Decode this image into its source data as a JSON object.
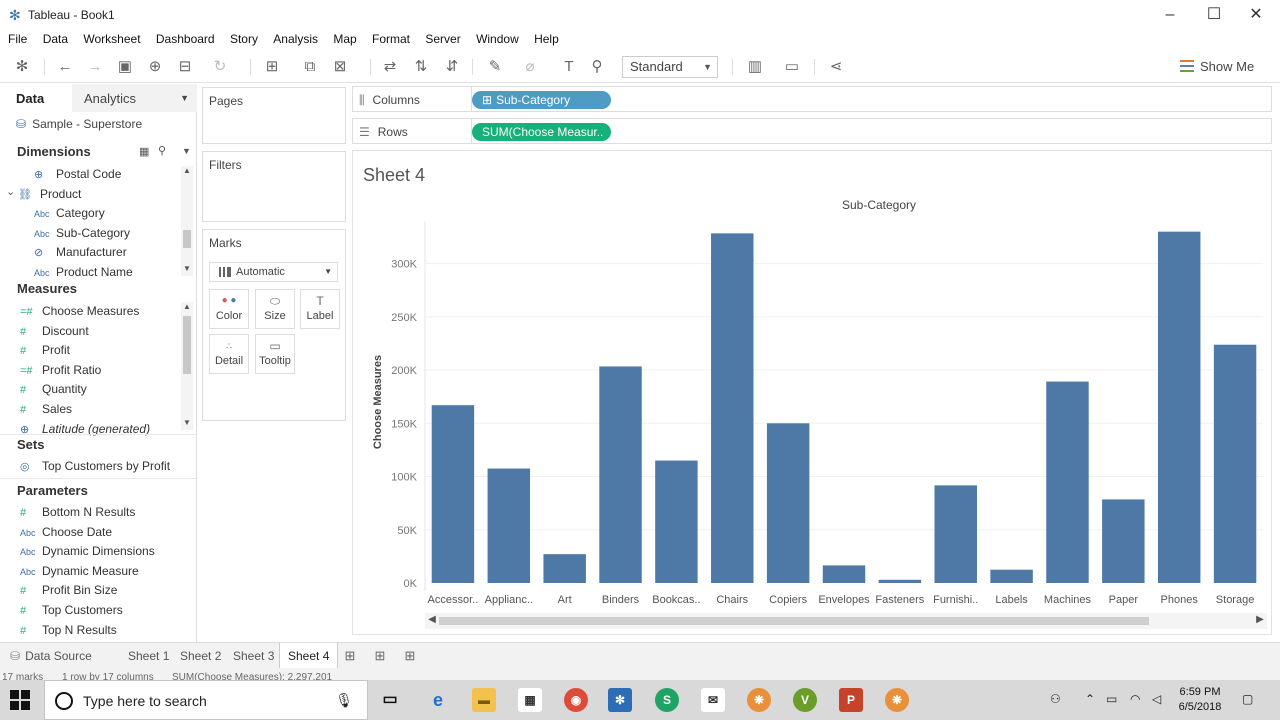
{
  "window": {
    "title": "Tableau - Book1"
  },
  "menu": [
    "File",
    "Data",
    "Worksheet",
    "Dashboard",
    "Story",
    "Analysis",
    "Map",
    "Format",
    "Server",
    "Window",
    "Help"
  ],
  "toolbar": {
    "fit_select": "Standard",
    "show_me": "Show Me"
  },
  "data_pane": {
    "tab_data": "Data",
    "tab_analytics": "Analytics",
    "data_source": "Sample - Superstore",
    "dimensions_label": "Dimensions",
    "dimensions": [
      {
        "icon": "globe-icon",
        "label": "Postal Code",
        "indent": 2
      },
      {
        "icon": "hierarchy-icon",
        "label": "Product",
        "indent": 1
      },
      {
        "icon": "abc-icon",
        "label": "Category",
        "indent": 2
      },
      {
        "icon": "abc-icon",
        "label": "Sub-Category",
        "indent": 2
      },
      {
        "icon": "paperclip-icon",
        "label": "Manufacturer",
        "indent": 2
      },
      {
        "icon": "abc-icon",
        "label": "Product Name",
        "indent": 2
      }
    ],
    "measures_label": "Measures",
    "measures": [
      {
        "icon": "calc-number-icon",
        "label": "Choose Measures"
      },
      {
        "icon": "number-icon",
        "label": "Discount"
      },
      {
        "icon": "number-icon",
        "label": "Profit"
      },
      {
        "icon": "calc-number-icon",
        "label": "Profit Ratio"
      },
      {
        "icon": "number-icon",
        "label": "Quantity"
      },
      {
        "icon": "number-icon",
        "label": "Sales"
      },
      {
        "icon": "globe-icon",
        "label": "Latitude (generated)"
      }
    ],
    "sets_label": "Sets",
    "sets": [
      {
        "icon": "set-icon",
        "label": "Top Customers by Profit"
      }
    ],
    "parameters_label": "Parameters",
    "parameters": [
      {
        "icon": "number-icon",
        "label": "Bottom N Results"
      },
      {
        "icon": "abc-icon",
        "label": "Choose Date"
      },
      {
        "icon": "abc-icon",
        "label": "Dynamic Dimensions"
      },
      {
        "icon": "abc-icon",
        "label": "Dynamic Measure"
      },
      {
        "icon": "number-icon",
        "label": "Profit Bin Size"
      },
      {
        "icon": "number-icon",
        "label": "Top Customers"
      },
      {
        "icon": "number-icon",
        "label": "Top N Results"
      }
    ]
  },
  "cards": {
    "pages": "Pages",
    "filters": "Filters",
    "marks": "Marks",
    "mark_type": "Automatic",
    "mark_buttons": [
      "Color",
      "Size",
      "Label",
      "Detail",
      "Tooltip"
    ]
  },
  "shelves": {
    "columns_label": "Columns",
    "rows_label": "Rows",
    "columns_pill": "Sub-Category",
    "rows_pill": "SUM(Choose Measur..",
    "columns_color": "#4e9cc4",
    "rows_color": "#16b07a"
  },
  "sheet": {
    "title": "Sheet 4"
  },
  "chart_data": {
    "type": "bar",
    "title": "Sub-Category",
    "xlabel": "",
    "ylabel": "Choose Measures",
    "categories": [
      "Accessor..",
      "Applianc..",
      "Art",
      "Binders",
      "Bookcas..",
      "Chairs",
      "Copiers",
      "Envelopes",
      "Fasteners",
      "Furnishi..",
      "Labels",
      "Machines",
      "Paper",
      "Phones",
      "Storage"
    ],
    "values": [
      167000,
      107500,
      27100,
      203400,
      115000,
      328400,
      150000,
      16500,
      3000,
      91700,
      12500,
      189200,
      78500,
      330000,
      223800
    ],
    "yticks": [
      0,
      50000,
      100000,
      150000,
      200000,
      250000,
      300000
    ],
    "ytick_labels": [
      "0K",
      "50K",
      "100K",
      "150K",
      "200K",
      "250K",
      "300K"
    ],
    "ylim": [
      0,
      340000
    ],
    "bar_color": "#4e79a7",
    "grid": true
  },
  "sheet_tabs": {
    "data_source": "Data Source",
    "sheets": [
      "Sheet 1",
      "Sheet 2",
      "Sheet 3",
      "Sheet 4"
    ],
    "active": "Sheet 4"
  },
  "status": {
    "marks": "17 marks",
    "dims": "1 row by 17 columns",
    "sum": "SUM(Choose Measures): 2,297,201"
  },
  "taskbar": {
    "search_placeholder": "Type here to search",
    "time": "6:59 PM",
    "date": "6/5/2018"
  }
}
